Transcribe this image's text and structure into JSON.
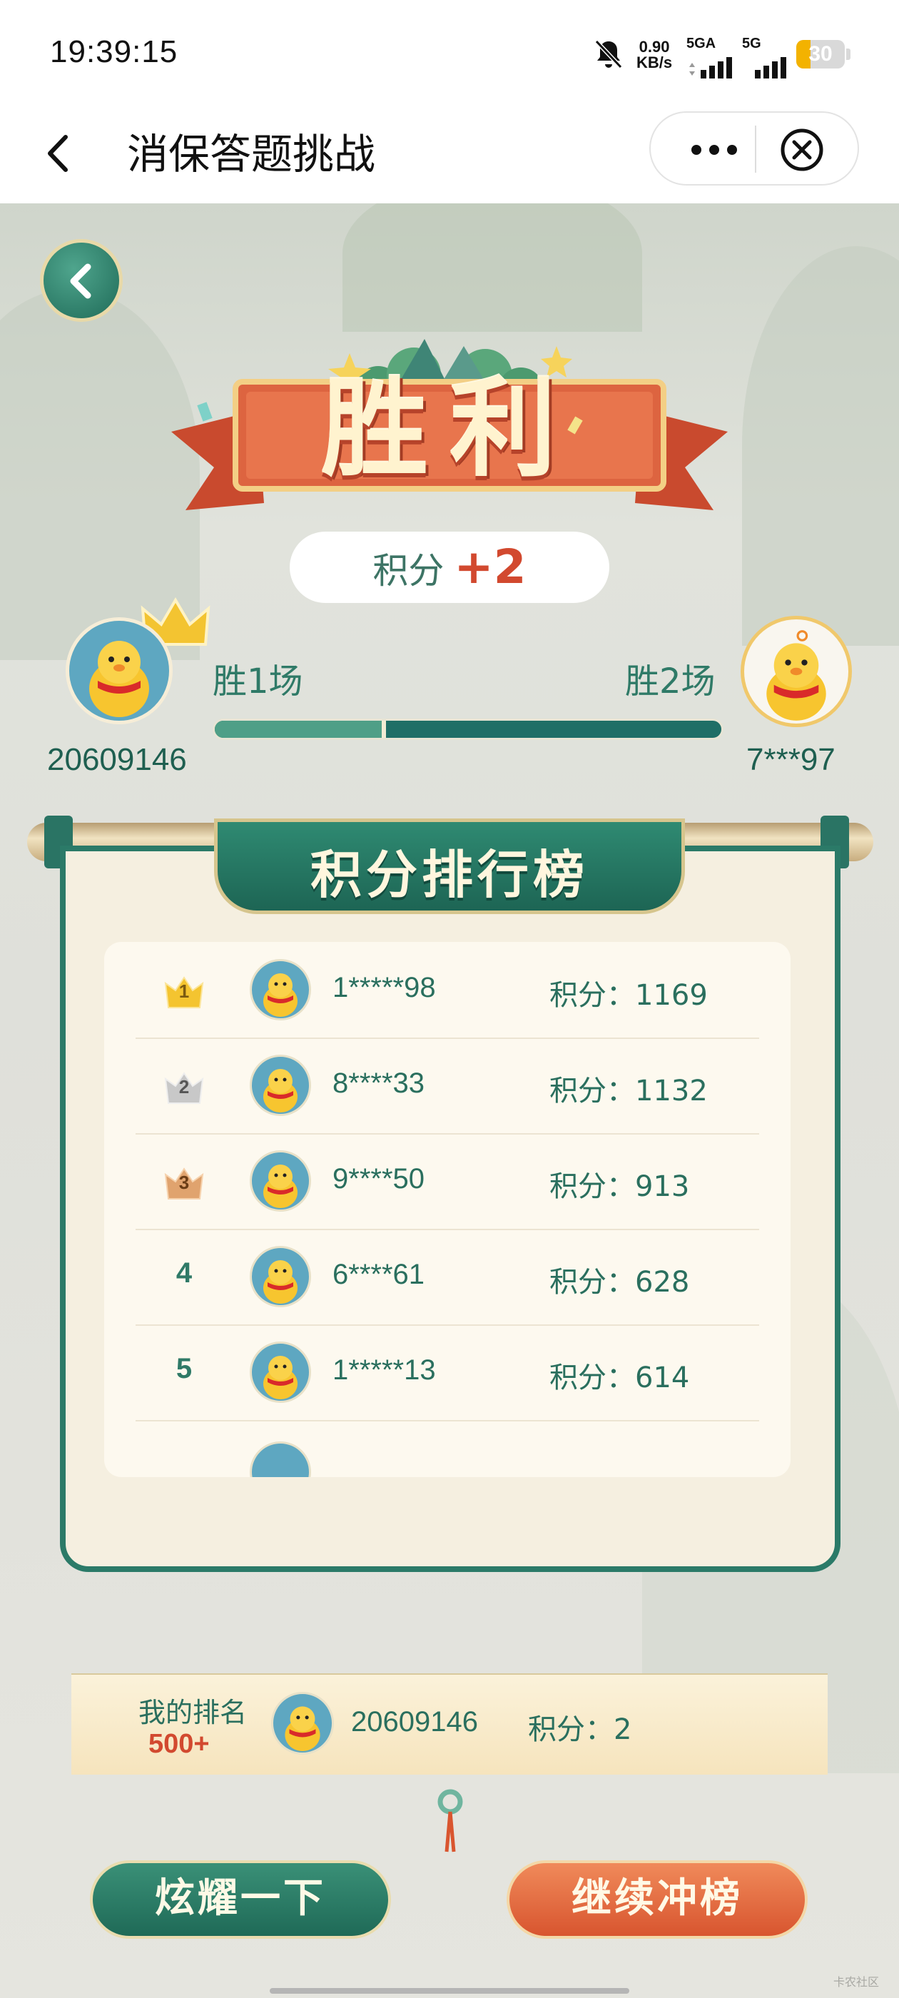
{
  "status_bar": {
    "time": "19:39:15",
    "net_speed_value": "0.90",
    "net_speed_unit": "KB/s",
    "signal1_label": "5GA",
    "signal2_label": "5G",
    "battery": "30",
    "battery_level": 0.3
  },
  "nav": {
    "title": "消保答题挑战"
  },
  "result": {
    "title": "胜利",
    "points_label": "积分",
    "points_delta": "+2"
  },
  "players": {
    "left": {
      "name": "20609146",
      "wins": "胜1场"
    },
    "right": {
      "name": "7***97",
      "wins": "胜2场"
    },
    "progress_left_share": 0.33
  },
  "leaderboard": {
    "title": "积分排行榜",
    "rows": [
      {
        "rank": "1",
        "name": "1*****98",
        "score": "积分：1169"
      },
      {
        "rank": "2",
        "name": "8****33",
        "score": "积分：1132"
      },
      {
        "rank": "3",
        "name": "9****50",
        "score": "积分：913"
      },
      {
        "rank": "4",
        "name": "6****61",
        "score": "积分：628"
      },
      {
        "rank": "5",
        "name": "1*****13",
        "score": "积分：614"
      }
    ],
    "my_rank_label": "我的排名",
    "my_rank": "500+",
    "my_name": "20609146",
    "my_score": "积分：2"
  },
  "buttons": {
    "show_off": "炫耀一下",
    "continue": "继续冲榜"
  },
  "watermark": "卡农社区",
  "colors": {
    "accent_green": "#2b7a68",
    "accent_orange": "#d8552f",
    "gold": "#f3c431"
  }
}
